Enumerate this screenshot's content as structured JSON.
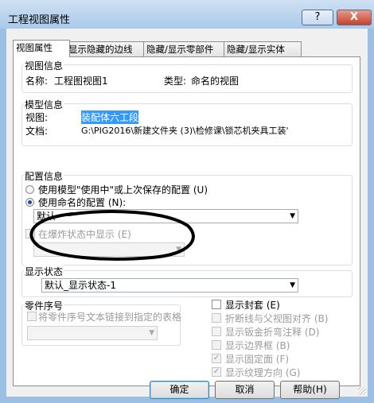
{
  "window": {
    "title": "工程视图属性",
    "help_glyph": "?",
    "close_glyph": "X"
  },
  "tabs": [
    "视图属性",
    "显示隐藏的边线",
    "隐藏/显示零部件",
    "隐藏/显示实体"
  ],
  "view_info": {
    "legend": "视图信息",
    "name_label": "名称:",
    "name_value": "工程图视图1",
    "type_label": "类型:",
    "type_value": "命名的视图"
  },
  "model_info": {
    "legend": "模型信息",
    "view_label": "视图:",
    "view_value": "装配体六工段",
    "doc_label": "文档:",
    "doc_value": "G:\\PIG2016\\新建文件夹 (3)\\检修课\\锁芯机夹具工装'"
  },
  "config_info": {
    "legend": "配置信息",
    "radio_use_model": "使用模型\"使用中\"或上次保存的配置 (U)",
    "radio_use_named": "使用命名的配置 (N):",
    "named_config_value": "默认",
    "exploded_checkbox": "在爆炸状态中显示 (E)",
    "selected_option": "use_named"
  },
  "display_state": {
    "legend": "显示状态",
    "value": "默认_显示状态-1"
  },
  "bom": {
    "legend": "零件序号",
    "link_checkbox": "将零件序号文本链接到指定的表格"
  },
  "options": [
    {
      "label": "显示封套 (E)",
      "checked": false,
      "enabled": true
    },
    {
      "label": "折断线与父视图对齐 (B)",
      "checked": false,
      "enabled": false
    },
    {
      "label": "显示钣金折弯注释 (D)",
      "checked": false,
      "enabled": false
    },
    {
      "label": "显示边界框 (B)",
      "checked": false,
      "enabled": false
    },
    {
      "label": "显示固定面 (F)",
      "checked": true,
      "enabled": false
    },
    {
      "label": "显示纹理方向 (G)",
      "checked": true,
      "enabled": false
    }
  ],
  "buttons": {
    "ok": "确定",
    "cancel": "取消",
    "help": "帮助(H)"
  }
}
